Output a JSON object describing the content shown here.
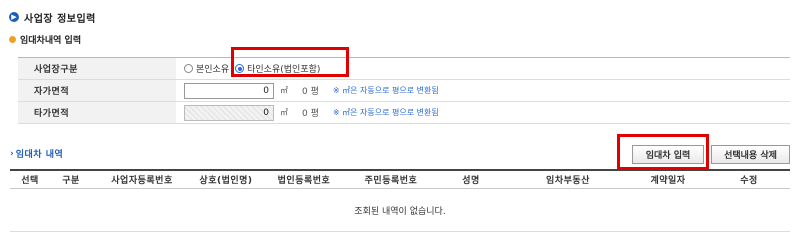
{
  "section_title": "사업장 정보입력",
  "sub_title": "임대차내역 입력",
  "form": {
    "workplace_type": {
      "label": "사업장구분",
      "options": [
        "본인소유",
        "타인소유(법인포함)"
      ],
      "selected": "타인소유(법인포함)"
    },
    "own_area": {
      "label": "자가면적",
      "value": "0",
      "unit": "㎡",
      "pyeong": "0 평",
      "note": "※ ㎡은 자동으로 평으로 변환됨"
    },
    "other_area": {
      "label": "타가면적",
      "value": "0",
      "unit": "㎡",
      "pyeong": "0 평",
      "note": "※ ㎡은 자동으로 평으로 변환됨"
    }
  },
  "list": {
    "title": "임대차 내역",
    "buttons": {
      "input": "임대차 입력",
      "delete": "선택내용 삭제"
    },
    "columns": [
      "선택",
      "구분",
      "사업자등록번호",
      "상호(법인명)",
      "법인등록번호",
      "주민등록번호",
      "성명",
      "임차부동산",
      "계약일자",
      "수정"
    ],
    "empty_message": "조회된 내역이 없습니다."
  },
  "colors": {
    "accent": "#1d5fb8",
    "highlight": "#e00000",
    "note": "#2a6ad8"
  }
}
